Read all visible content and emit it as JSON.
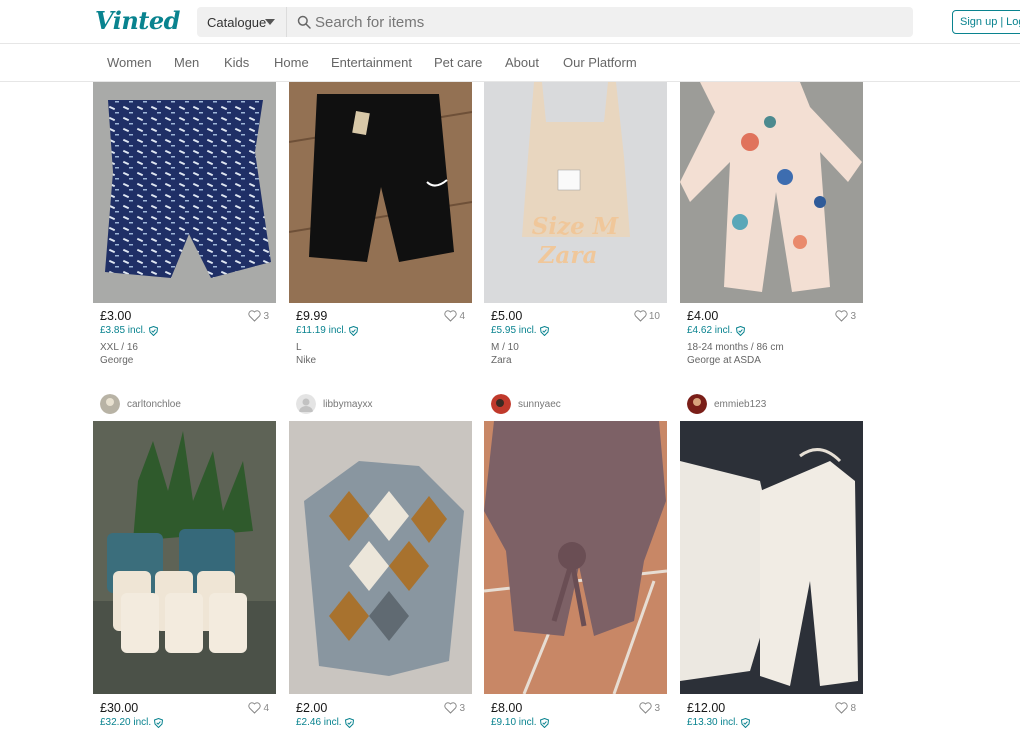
{
  "header": {
    "logo": "Vinted",
    "catalogue_label": "Catalogue",
    "search_placeholder": "Search for items",
    "signup_label": "Sign up",
    "separator": "|",
    "login_label": "Log"
  },
  "nav": {
    "items": [
      "Women",
      "Men",
      "Kids",
      "Home",
      "Entertainment",
      "Pet care",
      "About",
      "Our Platform"
    ]
  },
  "row1": [
    {
      "price": "£3.00",
      "incl": "£3.85 incl.",
      "favs": "3",
      "size": "XXL / 16",
      "brand": "George"
    },
    {
      "price": "£9.99",
      "incl": "£11.19 incl.",
      "favs": "4",
      "size": "L",
      "brand": "Nike"
    },
    {
      "price": "£5.00",
      "incl": "£5.95 incl.",
      "favs": "10",
      "size": "M / 10",
      "brand": "Zara",
      "overlay_line1": "Size M",
      "overlay_line2": "Zara"
    },
    {
      "price": "£4.00",
      "incl": "£4.62 incl.",
      "favs": "3",
      "size": "18-24 months / 86 cm",
      "brand": "George at ASDA"
    }
  ],
  "row2": [
    {
      "seller": "carltonchloe",
      "price": "£30.00",
      "incl": "£32.20 incl.",
      "favs": "4"
    },
    {
      "seller": "libbymayxx",
      "price": "£2.00",
      "incl": "£2.46 incl.",
      "favs": "3"
    },
    {
      "seller": "sunnyaec",
      "price": "£8.00",
      "incl": "£9.10 incl.",
      "favs": "3"
    },
    {
      "seller": "emmieb123",
      "price": "£12.00",
      "incl": "£13.30 incl.",
      "favs": "8"
    }
  ],
  "colors": {
    "brand": "#09838f",
    "text": "#171717",
    "muted": "#666666"
  },
  "icons": [
    "search-icon",
    "chevron-down-icon",
    "heart-icon",
    "shield-check-icon"
  ]
}
